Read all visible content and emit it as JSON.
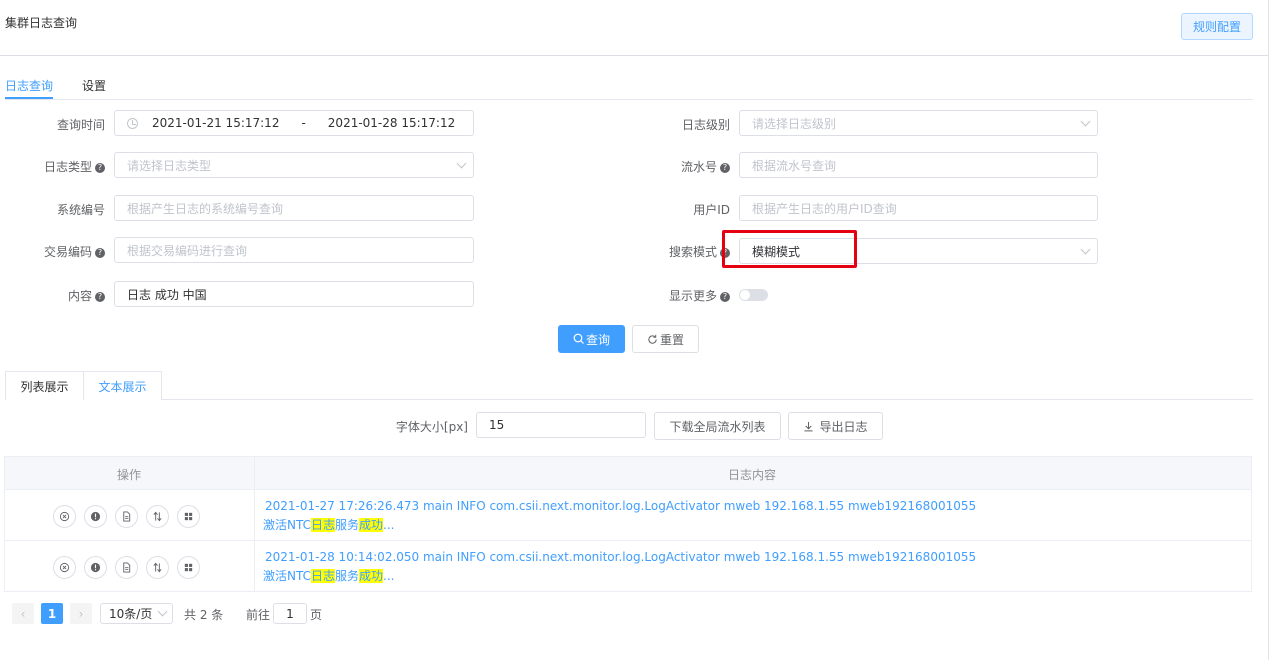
{
  "header": {
    "title": "集群日志查询",
    "rule_config": "规则配置"
  },
  "tabs": {
    "query": "日志查询",
    "settings": "设置"
  },
  "form": {
    "query_time": {
      "label": "查询时间",
      "start": "2021-01-21 15:17:12",
      "sep": "-",
      "end": "2021-01-28 15:17:12"
    },
    "log_level": {
      "label": "日志级别",
      "placeholder": "请选择日志级别"
    },
    "log_type": {
      "label": "日志类型",
      "placeholder": "请选择日志类型"
    },
    "serial_no": {
      "label": "流水号",
      "placeholder": "根据流水号查询"
    },
    "system_no": {
      "label": "系统编号",
      "placeholder": "根据产生日志的系统编号查询"
    },
    "user_id": {
      "label": "用户ID",
      "placeholder": "根据产生日志的用户ID查询"
    },
    "trade_code": {
      "label": "交易编码",
      "placeholder": "根据交易编码进行查询"
    },
    "search_mode": {
      "label": "搜索模式",
      "value": "模糊模式"
    },
    "content": {
      "label": "内容",
      "value": "日志 成功  中国"
    },
    "show_more": {
      "label": "显示更多",
      "enabled": false
    },
    "help_glyph": "?"
  },
  "actions": {
    "query": "查询",
    "reset": "重置"
  },
  "view_tabs": {
    "list": "列表展示",
    "text": "文本展示"
  },
  "toolbar": {
    "font_size_label": "字体大小[px]",
    "font_size_value": "15",
    "download": "下载全局流水列表",
    "export": "导出日志"
  },
  "table": {
    "columns": [
      "操作",
      "日志内容"
    ],
    "rows": [
      {
        "line1": "2021-01-27 17:26:26.473 main INFO com.csii.next.monitor.log.LogActivator     mweb 192.168.1.55 mweb192168001055",
        "pre": "激活NTC",
        "hl1": "日志",
        "mid": "服务",
        "hl2": "成功",
        "post": "..."
      },
      {
        "line1": "2021-01-28 10:14:02.050 main INFO com.csii.next.monitor.log.LogActivator     mweb 192.168.1.55 mweb192168001055",
        "pre": "激活NTC",
        "hl1": "日志",
        "mid": "服务",
        "hl2": "成功",
        "post": "..."
      }
    ]
  },
  "pagination": {
    "current": "1",
    "page_size": "10条/页",
    "total": "共 2 条",
    "goto": "前往",
    "goto_value": "1",
    "page_unit": "页",
    "prev": "‹",
    "next": "›"
  },
  "colors": {
    "accent": "#409eff",
    "highlight": "#ffff00",
    "annotation": "#e50012"
  }
}
